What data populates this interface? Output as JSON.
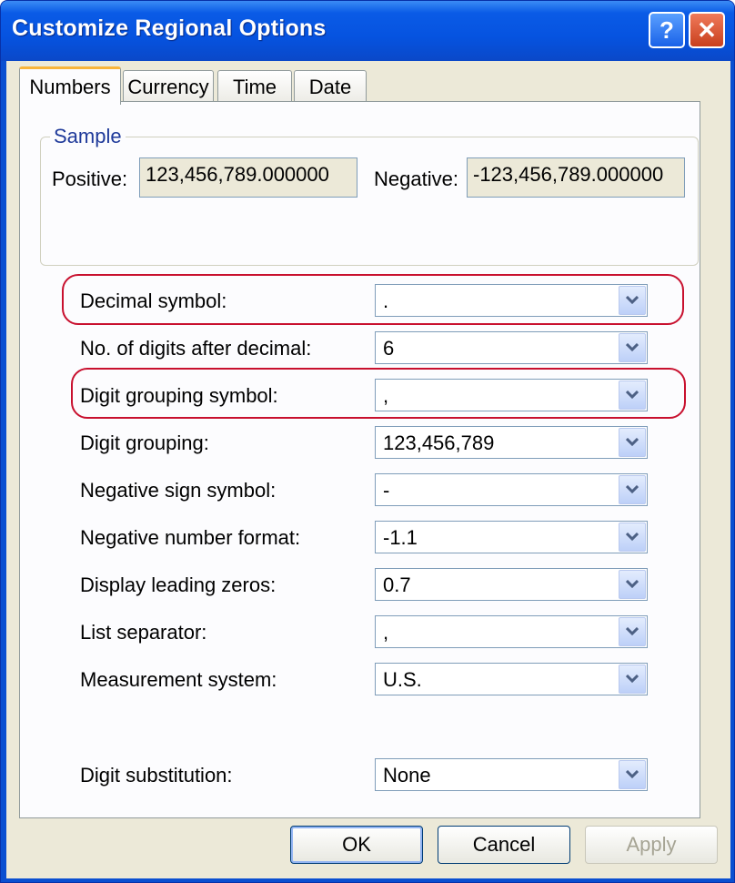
{
  "window": {
    "title": "Customize Regional Options",
    "help_label": "?",
    "close_label": "✕"
  },
  "tabs": [
    {
      "label": "Numbers",
      "active": true
    },
    {
      "label": "Currency",
      "active": false
    },
    {
      "label": "Time",
      "active": false
    },
    {
      "label": "Date",
      "active": false
    }
  ],
  "sample": {
    "legend": "Sample",
    "positive_label": "Positive:",
    "positive_value": "123,456,789.000000",
    "negative_label": "Negative:",
    "negative_value": "-123,456,789.000000"
  },
  "settings": [
    {
      "label": "Decimal symbol:",
      "value": "."
    },
    {
      "label": "No. of digits after decimal:",
      "value": "6"
    },
    {
      "label": "Digit grouping symbol:",
      "value": ","
    },
    {
      "label": "Digit grouping:",
      "value": "123,456,789"
    },
    {
      "label": "Negative sign symbol:",
      "value": "-"
    },
    {
      "label": "Negative number format:",
      "value": "-1.1"
    },
    {
      "label": "Display leading zeros:",
      "value": "0.7"
    },
    {
      "label": "List separator:",
      "value": ","
    },
    {
      "label": "Measurement system:",
      "value": "U.S."
    },
    {
      "label": "Digit substitution:",
      "value": "None"
    }
  ],
  "buttons": {
    "ok": "OK",
    "cancel": "Cancel",
    "apply": "Apply"
  },
  "colors": {
    "highlight": "#c8102e",
    "title_bar": "#0653e0",
    "face": "#ece9d8"
  }
}
